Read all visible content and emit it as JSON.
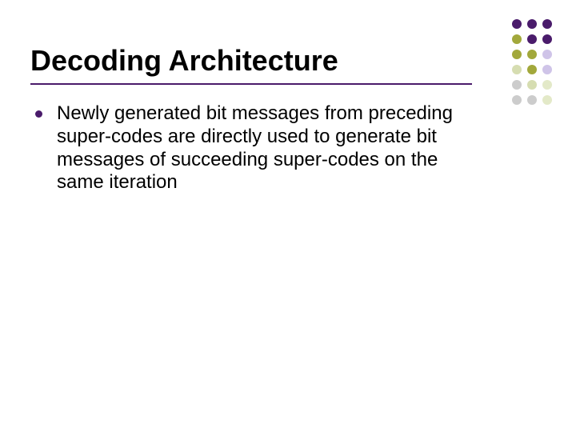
{
  "title": "Decoding Architecture",
  "bullets": [
    "Newly generated bit messages from preceding super-codes are directly used to generate bit messages of succeeding super-codes on the same iteration"
  ],
  "theme": {
    "accent": "#4a1b6b",
    "dot_colors": [
      "#4a1b6b",
      "#a2a83b",
      "#cfc4e8",
      "#d6ddb1",
      "#cccccc",
      "#e3e9c8"
    ]
  }
}
